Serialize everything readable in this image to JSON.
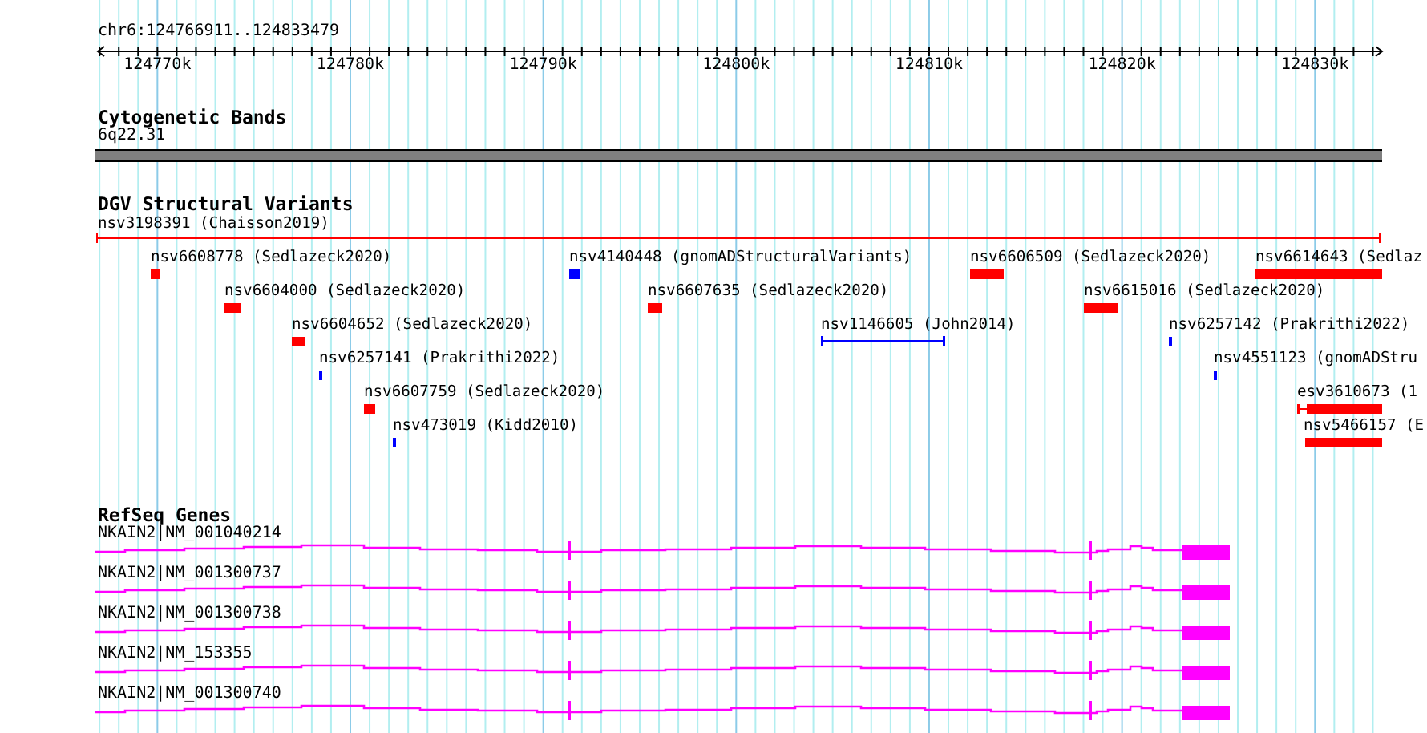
{
  "location": "chr6:124766911..124833479",
  "ruler": {
    "ticks": [
      "124770k",
      "124780k",
      "124790k",
      "124800k",
      "124810k",
      "124820k",
      "124830k"
    ]
  },
  "cytogenetic_bands": {
    "title": "Cytogenetic Bands",
    "band": "6q22.31"
  },
  "dgv": {
    "title": "DGV Structural Variants",
    "top": {
      "label": "nsv3198391 (Chaisson2019)",
      "kind": "span",
      "color": "#ff0000"
    },
    "rows": [
      {
        "items": [
          {
            "label": "nsv6608778 (Sedlazeck2020)",
            "kind": "bar",
            "color": "#ff0000"
          },
          {
            "label": "nsv4140448 (gnomADStructuralVariants)",
            "kind": "bar",
            "color": "#0000ff"
          },
          {
            "label": "nsv6606509 (Sedlazeck2020)",
            "kind": "bar",
            "color": "#ff0000"
          },
          {
            "label": "nsv6614643 (Sedlaz",
            "kind": "bar",
            "color": "#ff0000"
          }
        ]
      },
      {
        "items": [
          {
            "label": "nsv6604000 (Sedlazeck2020)",
            "kind": "bar",
            "color": "#ff0000"
          },
          {
            "label": "nsv6607635 (Sedlazeck2020)",
            "kind": "bar",
            "color": "#ff0000"
          },
          {
            "label": "nsv6615016 (Sedlazeck2020)",
            "kind": "bar",
            "color": "#ff0000"
          }
        ]
      },
      {
        "items": [
          {
            "label": "nsv6604652 (Sedlazeck2020)",
            "kind": "bar",
            "color": "#ff0000"
          },
          {
            "label": "nsv1146605 (John2014)",
            "kind": "span",
            "color": "#0000ff"
          },
          {
            "label": "nsv6257142 (Prakrithi2022)",
            "kind": "bar",
            "color": "#0000ff"
          }
        ]
      },
      {
        "items": [
          {
            "label": "nsv6257141 (Prakrithi2022)",
            "kind": "bar",
            "color": "#0000ff"
          },
          {
            "label": "nsv4551123 (gnomADStru",
            "kind": "bar",
            "color": "#0000ff"
          }
        ]
      },
      {
        "items": [
          {
            "label": "nsv6607759 (Sedlazeck2020)",
            "kind": "bar",
            "color": "#ff0000"
          },
          {
            "label": "esv3610673 (1",
            "kind": "tailed",
            "color": "#ff0000"
          }
        ]
      },
      {
        "items": [
          {
            "label": "nsv473019 (Kidd2010)",
            "kind": "bar",
            "color": "#0000ff"
          },
          {
            "label": "nsv5466157 (E",
            "kind": "bar",
            "color": "#ff0000"
          }
        ]
      }
    ]
  },
  "refseq": {
    "title": "RefSeq Genes",
    "genes": [
      {
        "label": "NKAIN2|NM_001040214"
      },
      {
        "label": "NKAIN2|NM_001300737"
      },
      {
        "label": "NKAIN2|NM_001300738"
      },
      {
        "label": "NKAIN2|NM_153355"
      },
      {
        "label": "NKAIN2|NM_001300740"
      }
    ]
  }
}
